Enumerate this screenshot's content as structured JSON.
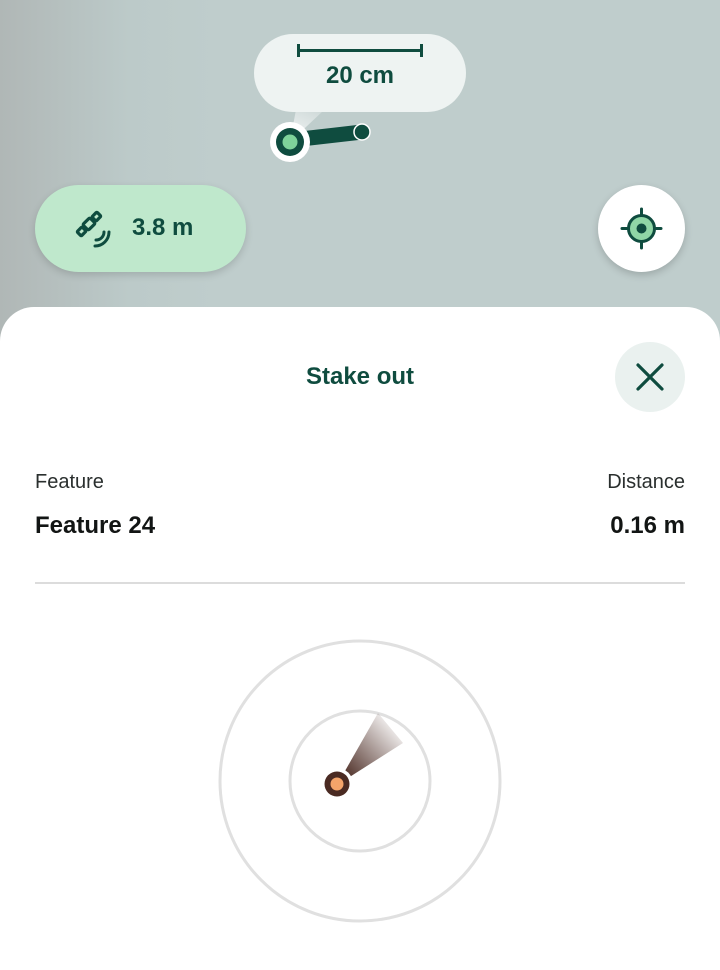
{
  "map": {
    "scale_label": "20 cm",
    "gps_accuracy_label": "3.8 m",
    "colors": {
      "map_background": "#bfcdcc",
      "brand_dark": "#0f4c3f",
      "position_green": "#7ed29a",
      "gps_pill": "#bfe8cc"
    },
    "icons": {
      "gps": "satellite-icon",
      "locate": "crosshair-icon"
    }
  },
  "stakeout": {
    "title": "Stake out",
    "feature_label": "Feature",
    "feature_value": "Feature 24",
    "distance_label": "Distance",
    "distance_value": "0.16 m",
    "icons": {
      "close": "close-icon"
    },
    "colors": {
      "target_orange": "#f4a46a",
      "target_dark": "#4a2a22",
      "ring": "#e0e0e0"
    }
  }
}
